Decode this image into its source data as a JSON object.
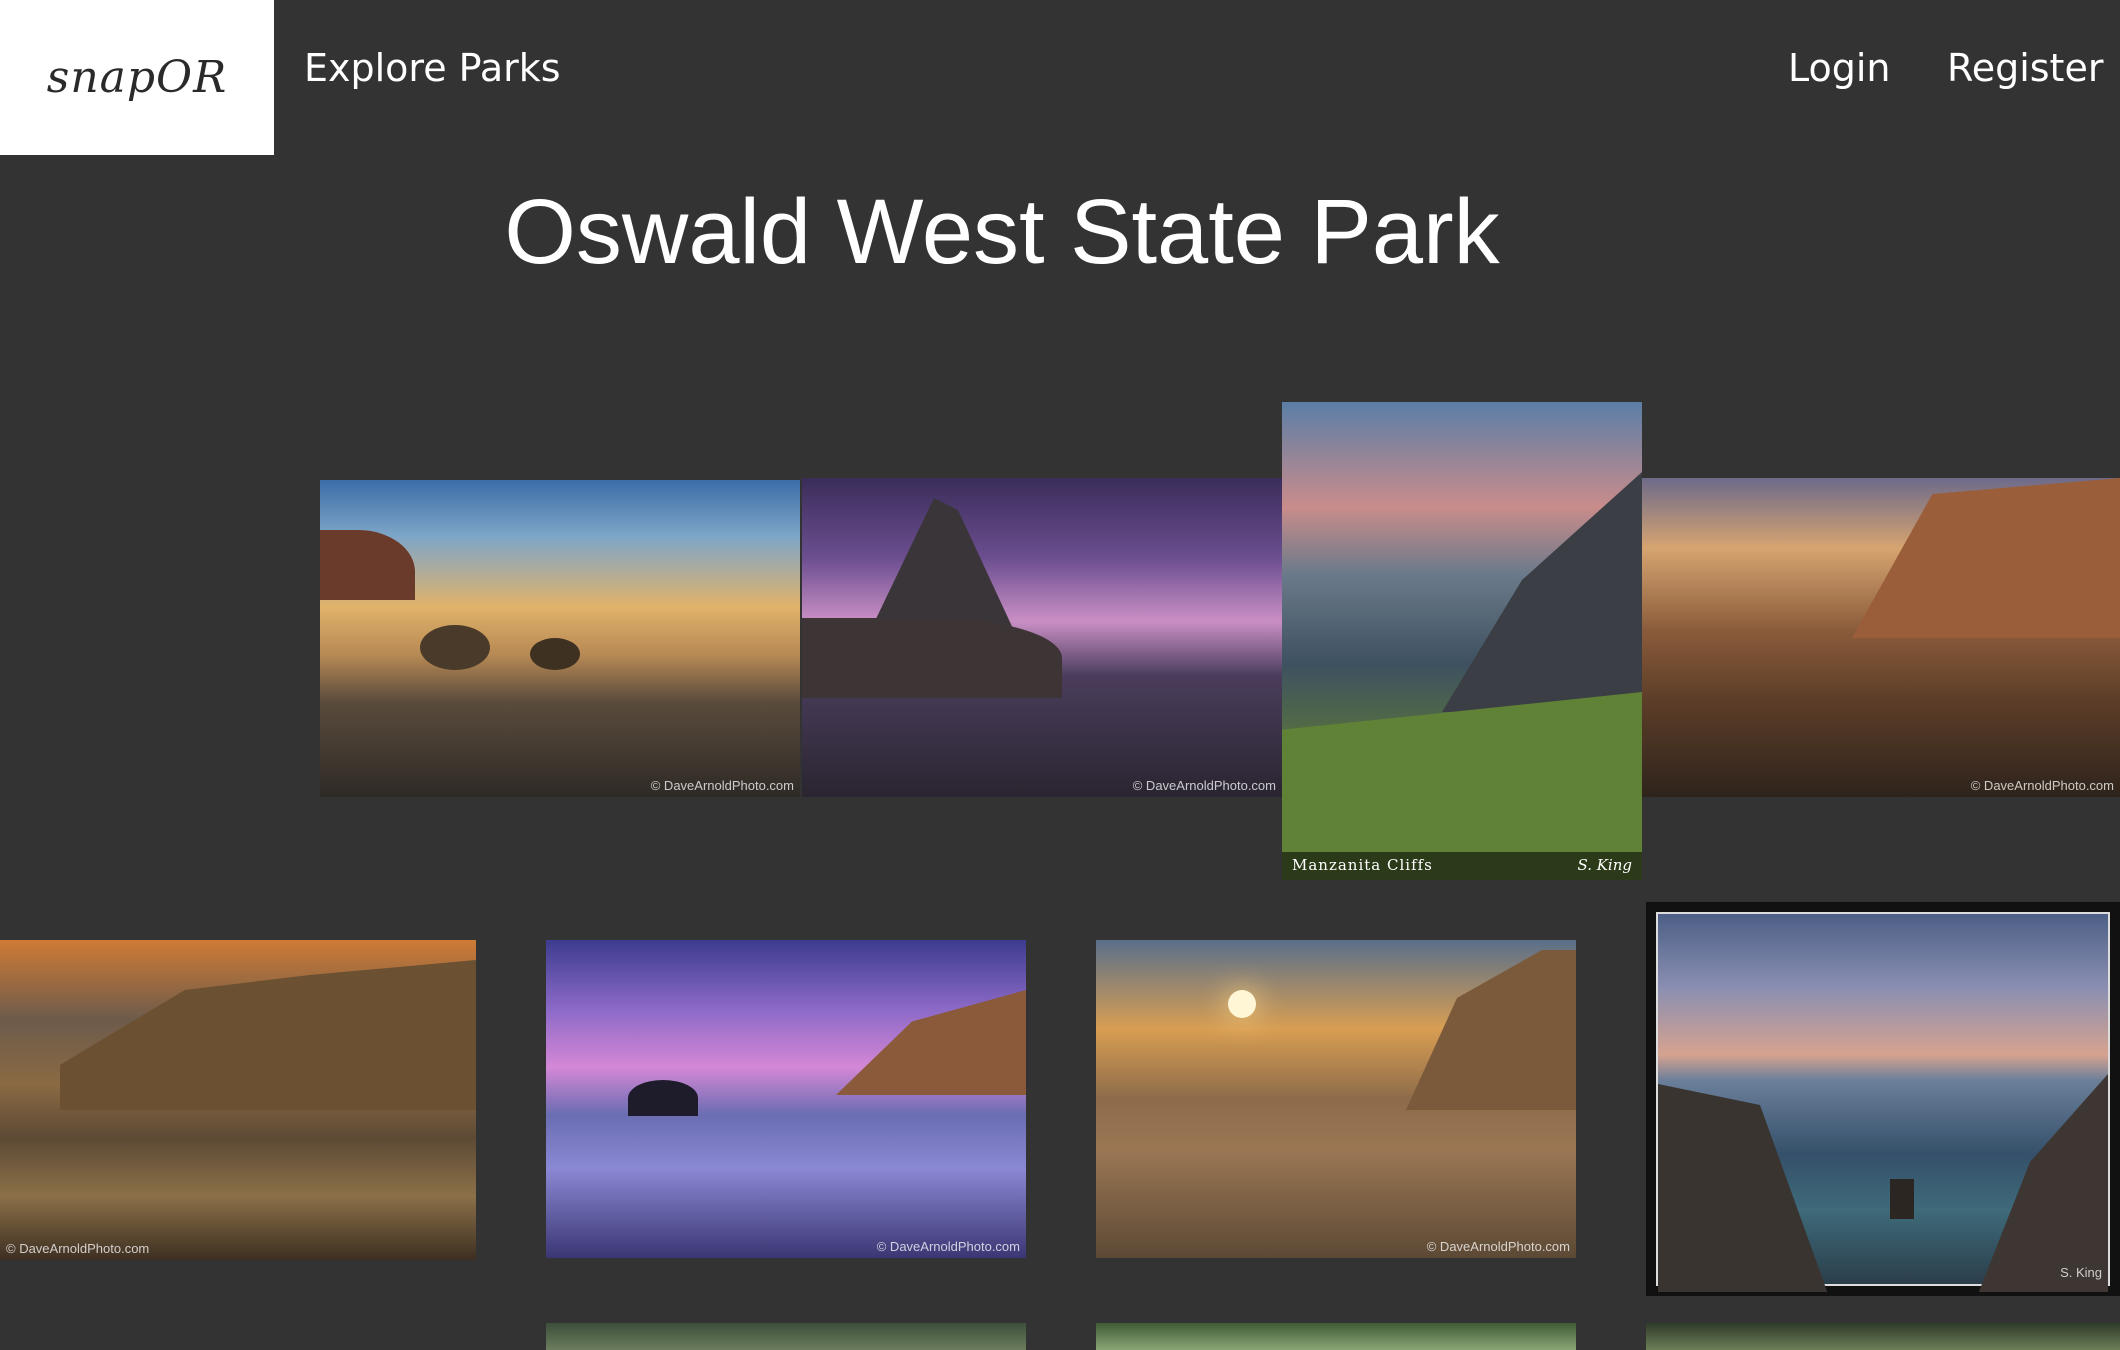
{
  "header": {
    "logo_text": "snapOR",
    "nav_left": "Explore Parks",
    "nav_login": "Login",
    "nav_register": "Register"
  },
  "page": {
    "title": "Oswald West State Park"
  },
  "colors": {
    "background": "#333333",
    "logo_bg": "#ffffff",
    "text": "#ffffff"
  },
  "photos": {
    "p1_watermark": "© DaveArnoldPhoto.com",
    "p2_watermark": "© DaveArnoldPhoto.com",
    "p3_caption_left": "Manzanita Cliffs",
    "p3_caption_right": "S. King",
    "p4_watermark": "© DaveArnoldPhoto.com",
    "p5_watermark": "© DaveArnoldPhoto.com",
    "p6_watermark": "© DaveArnoldPhoto.com",
    "p7_watermark": "© DaveArnoldPhoto.com",
    "p8_watermark": "S. King"
  }
}
